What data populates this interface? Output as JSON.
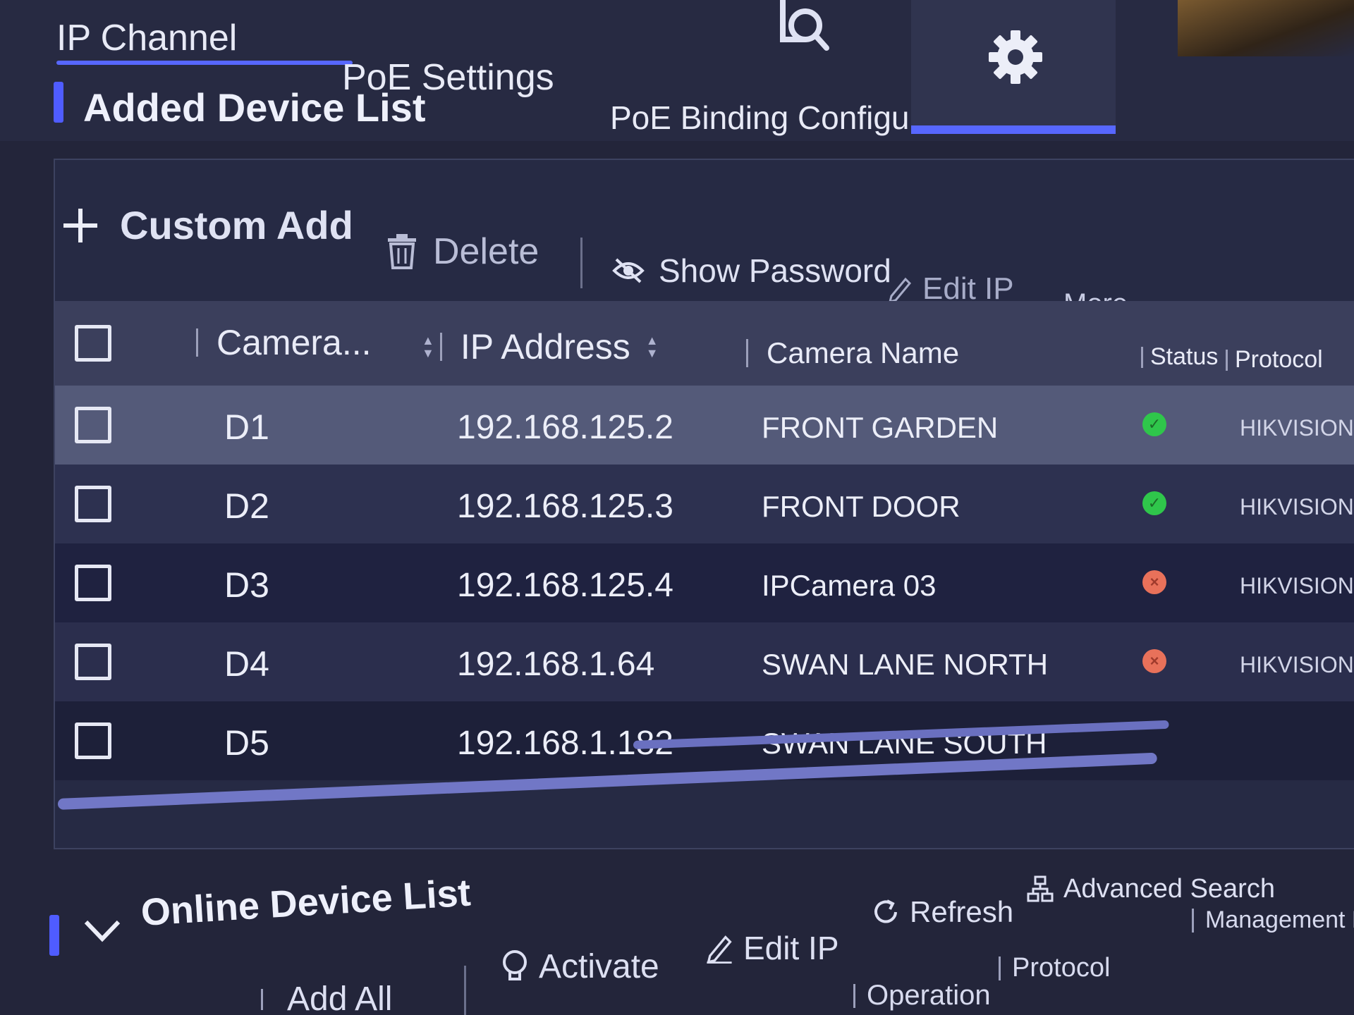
{
  "tabs": [
    {
      "label": "IP Channel",
      "active": true
    },
    {
      "label": "PoE Settings",
      "active": false
    },
    {
      "label": "PoE Binding Configuration",
      "active": false
    }
  ],
  "nav_icons": [
    "search-document-icon",
    "gear-icon"
  ],
  "added_list": {
    "title": "Added Device List",
    "toolbar": {
      "custom_add": "Custom Add",
      "delete": "Delete",
      "show_password": "Show Password",
      "edit_ip": "Edit IP",
      "more": "More"
    },
    "columns": {
      "channel": "Camera...",
      "ip": "IP Address",
      "name": "Camera Name",
      "status": "Status",
      "protocol": "Protocol"
    },
    "rows": [
      {
        "channel": "D1",
        "ip": "192.168.125.2",
        "name": "FRONT GARDEN",
        "status": "online",
        "protocol": "HIKVISION"
      },
      {
        "channel": "D2",
        "ip": "192.168.125.3",
        "name": "FRONT DOOR",
        "status": "online",
        "protocol": "HIKVISION"
      },
      {
        "channel": "D3",
        "ip": "192.168.125.4",
        "name": "IPCamera 03",
        "status": "offline",
        "protocol": "HIKVISION"
      },
      {
        "channel": "D4",
        "ip": "192.168.1.64",
        "name": "SWAN LANE NORTH",
        "status": "offline",
        "protocol": "HIKVISION"
      },
      {
        "channel": "D5",
        "ip": "192.168.1.182",
        "name": "SWAN LANE SOUTH",
        "status": "",
        "protocol": ""
      }
    ]
  },
  "online_list": {
    "title": "Online Device List",
    "toolbar": {
      "add_all": "Add All",
      "activate": "Activate",
      "edit_ip": "Edit IP",
      "refresh": "Refresh",
      "advanced_search": "Advanced Search"
    },
    "columns": {
      "operation": "Operation",
      "protocol": "Protocol",
      "management_port": "Management Port"
    }
  },
  "colors": {
    "accent": "#5767ff",
    "online": "#2fc64b",
    "offline": "#e8715a",
    "background": "#23253a"
  }
}
